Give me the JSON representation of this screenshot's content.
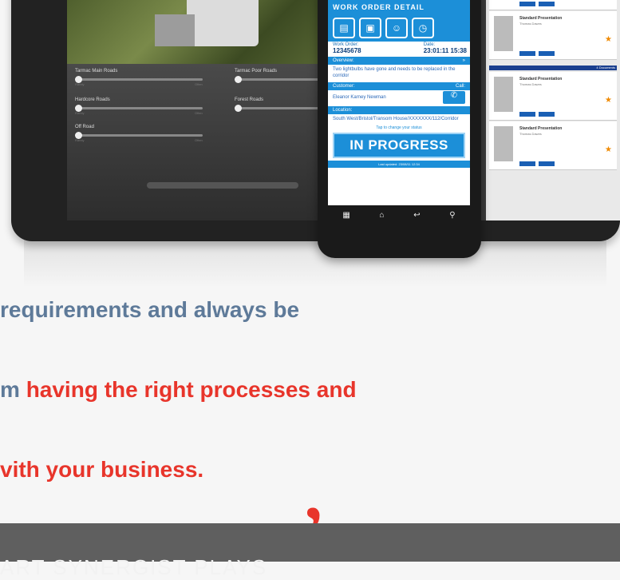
{
  "tablet": {
    "sliders": [
      {
        "label": "Tarmac Main Roads",
        "min": "Rarely",
        "max": "Often"
      },
      {
        "label": "Tarmac Poor Roads",
        "min": "Rarely",
        "max": "Often"
      },
      {
        "label": "Hardcore Roads",
        "min": "Rarely",
        "max": "Often"
      },
      {
        "label": "Forest Roads",
        "min": "Rarely",
        "max": "Often"
      },
      {
        "label": "Off Road",
        "min": "Rarely",
        "max": "Often"
      }
    ],
    "documents": [
      {
        "title": "Standard Presentation",
        "subtitle": "Thomas Dawes"
      },
      {
        "title": "Standard Presentation",
        "subtitle": "Thomas Dawes"
      },
      {
        "title": "Standard Presentation",
        "subtitle": "Thomas Dawes"
      }
    ],
    "doc_header": "4 Documents"
  },
  "phone": {
    "title": "WORK ORDER DETAIL",
    "work_order_label": "Work Order:",
    "work_order_value": "12345678",
    "date_label": "Date:",
    "date_value": "23:01:11  15:38",
    "overview_label": "Overview:",
    "overview_text": "Two lightbulbs have gone and needs to be replaced in the corridor",
    "customer_label": "Customer:",
    "call_label": "Call:",
    "customer_value": "Eleanor Karney Newman",
    "location_label": "Location:",
    "location_value": "South West/Bristol/Transom House/XXXXXXX/112/Corridor",
    "tap_note": "Tap to change your status",
    "status": "IN PROGRESS",
    "last_updated": "Last updated: 23/08/11 12:34"
  },
  "quote": {
    "line1": "requirements and always be",
    "line2_prefix": "m ",
    "line2_highlight": "having the right processes and",
    "line3": "vith your business."
  },
  "footer": {
    "text": "ART SYNERGIST PLAYS"
  },
  "colors": {
    "accent_blue": "#1c8fd8",
    "quote_grey": "#5e7a99",
    "quote_red": "#e8352b"
  }
}
